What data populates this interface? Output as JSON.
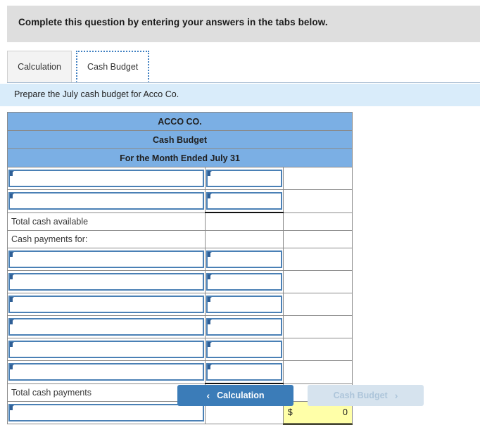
{
  "instruction": {
    "text": "Complete this question by entering your answers in the tabs below."
  },
  "tabs": [
    {
      "label": "Calculation",
      "active": false
    },
    {
      "label": "Cash Budget",
      "active": true
    }
  ],
  "sub_instruction": {
    "text": "Prepare the July cash budget for Acco Co."
  },
  "worksheet": {
    "title_lines": [
      "ACCO CO.",
      "Cash Budget",
      "For the Month Ended July 31"
    ],
    "rows": [
      {
        "type": "input",
        "label": "",
        "input_a": "",
        "input_b": "",
        "col_c": ""
      },
      {
        "type": "input",
        "label": "",
        "input_a": "",
        "input_b": "",
        "col_c": ""
      },
      {
        "type": "label",
        "label": "Total cash available",
        "col_b": "",
        "col_c": ""
      },
      {
        "type": "label",
        "label": "Cash payments for:",
        "col_b": "",
        "col_c": ""
      },
      {
        "type": "input",
        "label": "",
        "input_a": "",
        "input_b": "",
        "col_c": ""
      },
      {
        "type": "input",
        "label": "",
        "input_a": "",
        "input_b": "",
        "col_c": ""
      },
      {
        "type": "input",
        "label": "",
        "input_a": "",
        "input_b": "",
        "col_c": ""
      },
      {
        "type": "input",
        "label": "",
        "input_a": "",
        "input_b": "",
        "col_c": ""
      },
      {
        "type": "input",
        "label": "",
        "input_a": "",
        "input_b": "",
        "col_c": ""
      },
      {
        "type": "input",
        "label": "",
        "input_a": "",
        "input_b": "",
        "col_c": ""
      },
      {
        "type": "label",
        "label": "Total cash payments",
        "col_b": "",
        "col_c": ""
      },
      {
        "type": "final",
        "label": "",
        "input_a": "",
        "col_b": "",
        "currency": "$",
        "total": "0"
      }
    ]
  },
  "navigation": {
    "prev_label": "Calculation",
    "prev_icon": "chevron-left-icon",
    "prev_glyph": "‹",
    "next_label": "Cash Budget",
    "next_icon": "chevron-right-icon",
    "next_glyph": "›",
    "next_disabled": true
  },
  "colors": {
    "header_band": "#7bafe4",
    "instruction_bar": "#dedede",
    "sub_banner": "#d9ecfa",
    "input_border": "#4a80b5",
    "total_highlight": "#ffffa8",
    "button_primary": "#3b7cb8",
    "button_disabled": "#d6e3ee"
  }
}
